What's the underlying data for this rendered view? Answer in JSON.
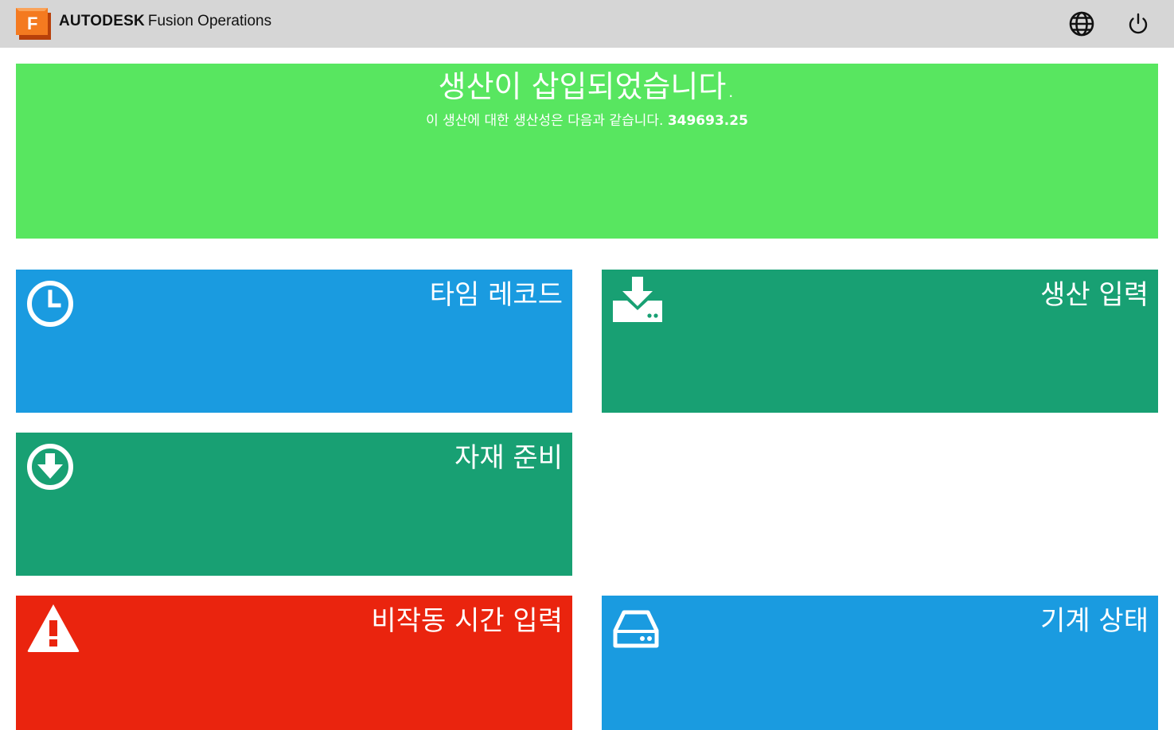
{
  "header": {
    "brand_autodesk": "AUTODESK",
    "brand_product": "Fusion Operations",
    "logo_letter": "F",
    "icons": [
      "globe-icon",
      "power-icon"
    ]
  },
  "banner": {
    "title": "생산이 삽입되었습니다.",
    "subtitle": "이 생산에 대한 생산성은 다음과 같습니다.",
    "value": "349693.25",
    "color": "#58e660"
  },
  "tiles": [
    {
      "label": "타임 레코드",
      "icon": "clock-icon",
      "color": "#1a9be0"
    },
    {
      "label": "생산 입력",
      "icon": "download-tray-icon",
      "color": "#18a073"
    },
    {
      "label": "자재 준비",
      "icon": "arrow-down-circle-icon",
      "color": "#18a073"
    },
    {
      "label": "비작동 시간 입력",
      "icon": "warning-icon",
      "color": "#ea240e"
    },
    {
      "label": "기계 상태",
      "icon": "hard-drive-icon",
      "color": "#1a9be0"
    }
  ]
}
